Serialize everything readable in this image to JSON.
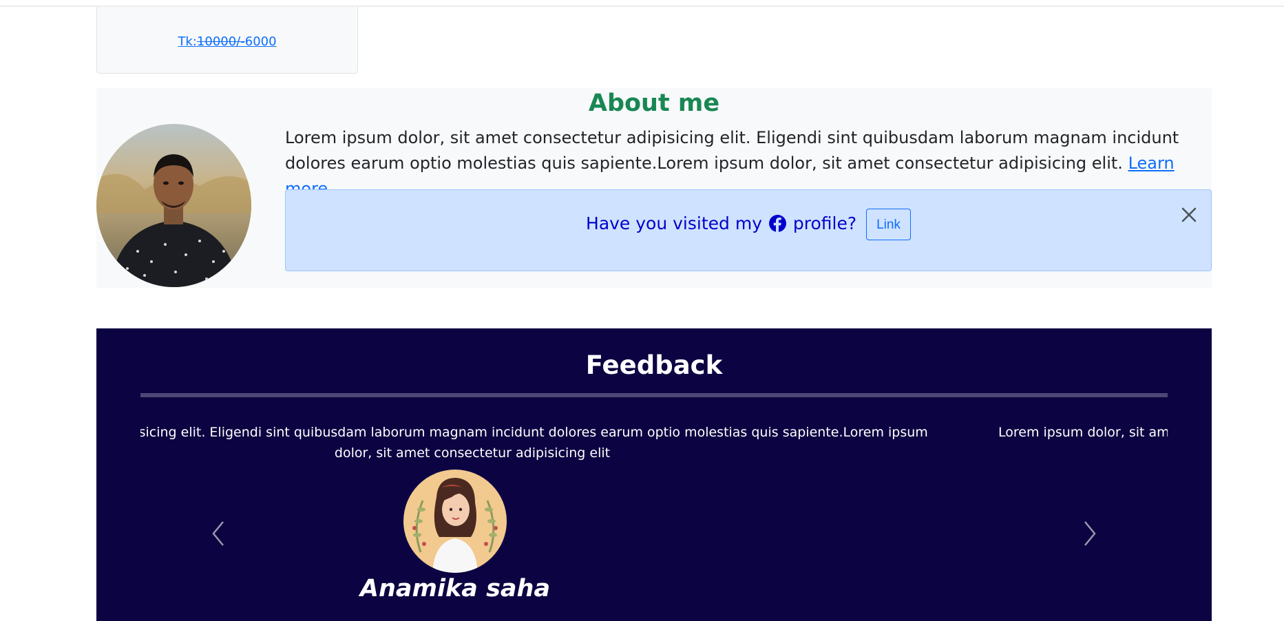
{
  "price_card": {
    "prefix": "Tk:",
    "old_price": "10000/-",
    "new_price": "6000"
  },
  "about": {
    "title": "About me",
    "text": "Lorem ipsum dolor, sit amet consectetur adipisicing elit. Eligendi sint quibusdam laborum magnam incidunt dolores earum optio molestias quis sapiente.Lorem ipsum dolor, sit amet consectetur adipisicing elit.",
    "learn_more": "Learn more..."
  },
  "alert": {
    "prefix": "Have you visited my",
    "suffix": "profile?",
    "link_label": "Link",
    "icon": "facebook-icon",
    "close_icon": "close-icon"
  },
  "feedback": {
    "title": "Feedback",
    "slides": [
      {
        "text": ": consectetur adipisicing elit. Eligendi sint quibusdam laborum magnam incidunt dolores earum optio molestias quis sapiente.Lorem ipsum dolor, sit amet consectetur adipisicing elit",
        "name": "Anamika saha"
      },
      {
        "text": "Lorem ipsum dolor, sit amet"
      }
    ],
    "prev_icon": "chevron-left-icon",
    "next_icon": "chevron-right-icon"
  },
  "colors": {
    "about_title": "#198754",
    "link": "#0d6efd",
    "alert_bg": "#cfe2ff",
    "alert_text": "#0000cd",
    "feedback_bg": "#0c0442"
  }
}
